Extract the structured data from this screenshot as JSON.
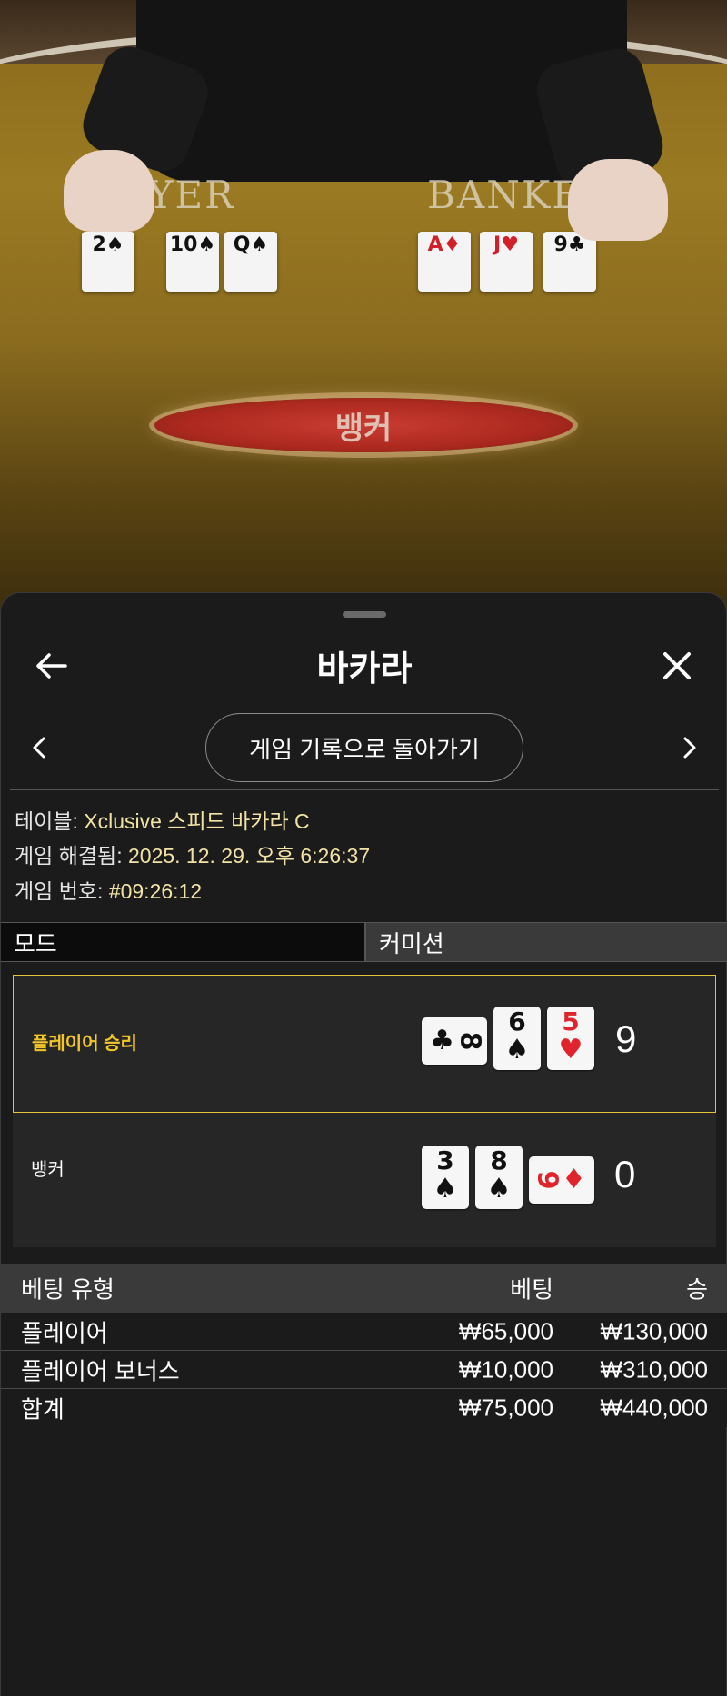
{
  "video": {
    "player_label": "PLAYER",
    "banker_label": "BANKER",
    "result_text": "뱅커",
    "player_cards": [
      {
        "rank": "2",
        "suit": "♠",
        "red": false
      },
      {
        "rank": "10",
        "suit": "♠",
        "red": false
      },
      {
        "rank": "Q",
        "suit": "♠",
        "red": false
      }
    ],
    "banker_cards": [
      {
        "rank": "A",
        "suit": "♦",
        "red": true
      },
      {
        "rank": "J",
        "suit": "♥",
        "red": true
      },
      {
        "rank": "9",
        "suit": "♣",
        "red": false
      }
    ]
  },
  "header": {
    "title": "바카라"
  },
  "nav": {
    "back_to_history": "게임 기록으로 돌아가기"
  },
  "info": {
    "table_key": "테이블:",
    "table_value": "Xclusive 스피드 바카라 C",
    "resolved_key": "게임 해결됨:",
    "resolved_value": "2025. 12. 29. 오후 6:26:37",
    "number_key": "게임 번호:",
    "number_value": "#09:26:12"
  },
  "tabs": {
    "mode": "모드",
    "commission": "커미션"
  },
  "hands": {
    "player": {
      "label": "플레이어 승리",
      "score": "9",
      "cards": [
        {
          "rank": "8",
          "suit": "♣",
          "red": false,
          "sideways": true
        },
        {
          "rank": "6",
          "suit": "♠",
          "red": false,
          "sideways": false
        },
        {
          "rank": "5",
          "suit": "♥",
          "red": true,
          "sideways": false
        }
      ]
    },
    "banker": {
      "label": "뱅커",
      "score": "0",
      "cards": [
        {
          "rank": "3",
          "suit": "♠",
          "red": false,
          "sideways": false
        },
        {
          "rank": "8",
          "suit": "♠",
          "red": false,
          "sideways": false
        },
        {
          "rank": "9",
          "suit": "♦",
          "red": true,
          "sideways": true
        }
      ]
    }
  },
  "bets": {
    "headers": {
      "type": "베팅 유형",
      "bet": "베팅",
      "win": "승"
    },
    "rows": [
      {
        "type": "플레이어",
        "bet": "₩65,000",
        "win": "₩130,000"
      },
      {
        "type": "플레이어 보너스",
        "bet": "₩10,000",
        "win": "₩310,000"
      }
    ],
    "total": {
      "type": "합계",
      "bet": "₩75,000",
      "win": "₩440,000"
    }
  },
  "colors": {
    "accent_gold": "#f3c62a",
    "info_value": "#f2e2a6",
    "result_red": "#b22620"
  }
}
